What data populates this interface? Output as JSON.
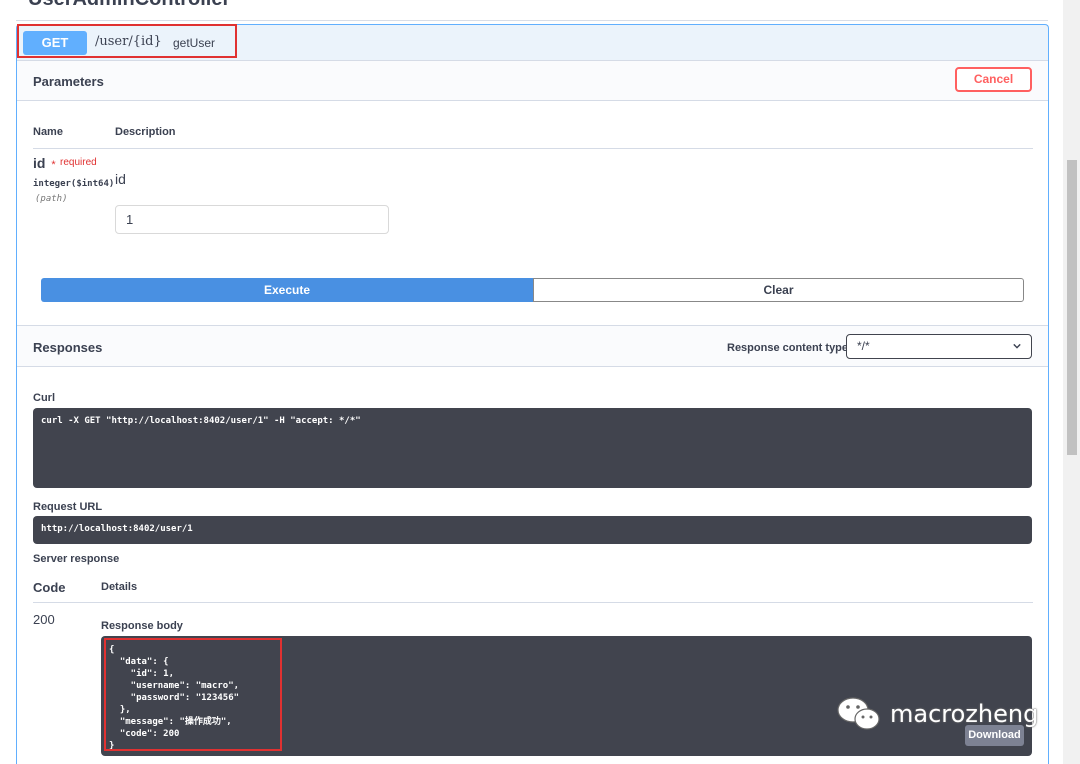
{
  "page": {
    "section_title": "UserAdminController"
  },
  "operation": {
    "method": "GET",
    "path": "/user/{id}",
    "operation_id": "getUser",
    "accent_color": "#61affe"
  },
  "parameters": {
    "title": "Parameters",
    "cancel_label": "Cancel",
    "col_name": "Name",
    "col_description": "Description",
    "items": [
      {
        "name": "id",
        "required_star": "*",
        "required_label": "required",
        "type": "integer($int64)",
        "in": "(path)",
        "description": "id",
        "value": "1"
      }
    ]
  },
  "actions": {
    "execute_label": "Execute",
    "clear_label": "Clear"
  },
  "responses": {
    "title": "Responses",
    "content_type_label": "Response content type",
    "content_type_value": "*/*"
  },
  "curl": {
    "label": "Curl",
    "command": "curl -X GET \"http://localhost:8402/user/1\" -H \"accept: */*\""
  },
  "request_url": {
    "label": "Request URL",
    "value": "http://localhost:8402/user/1"
  },
  "server_response": {
    "label": "Server response",
    "col_code": "Code",
    "col_details": "Details",
    "code": "200",
    "body_label": "Response body",
    "body": "{\n  \"data\": {\n    \"id\": 1,\n    \"username\": \"macro\",\n    \"password\": \"123456\"\n  },\n  \"message\": \"操作成功\",\n  \"code\": 200\n}",
    "download_label": "Download"
  },
  "watermark": {
    "text": "macrozheng"
  }
}
